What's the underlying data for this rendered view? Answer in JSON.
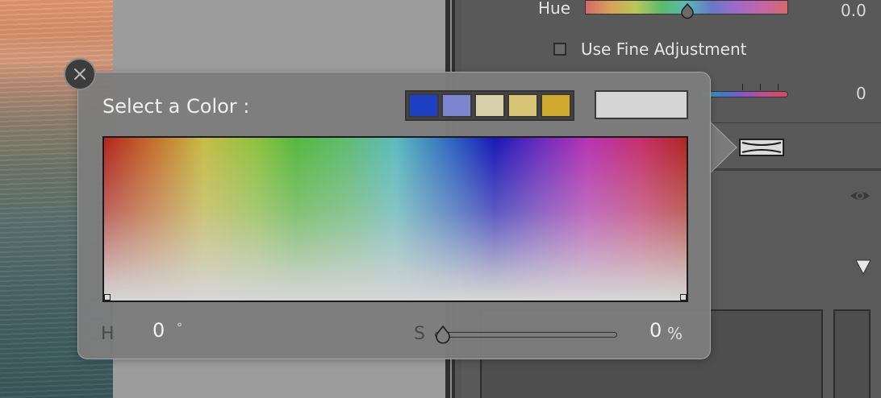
{
  "right_panel": {
    "hue_label": "Hue",
    "hue_value": "0.0",
    "fine_adjustment_label": "Use Fine Adjustment",
    "saturation_value": "0"
  },
  "color_picker": {
    "title": "Select a Color :",
    "swatches": [
      {
        "color": "#1d3fc4"
      },
      {
        "color": "#7b86cf"
      },
      {
        "color": "#d8d0a8"
      },
      {
        "color": "#d7c474"
      },
      {
        "color": "#d0aa2f"
      }
    ],
    "current_color": "#d5d5d5",
    "h_label": "H",
    "h_value": "0",
    "h_unit": "°",
    "s_label": "S",
    "s_value": "0",
    "s_unit": "%",
    "saturation_fraction": 0
  }
}
